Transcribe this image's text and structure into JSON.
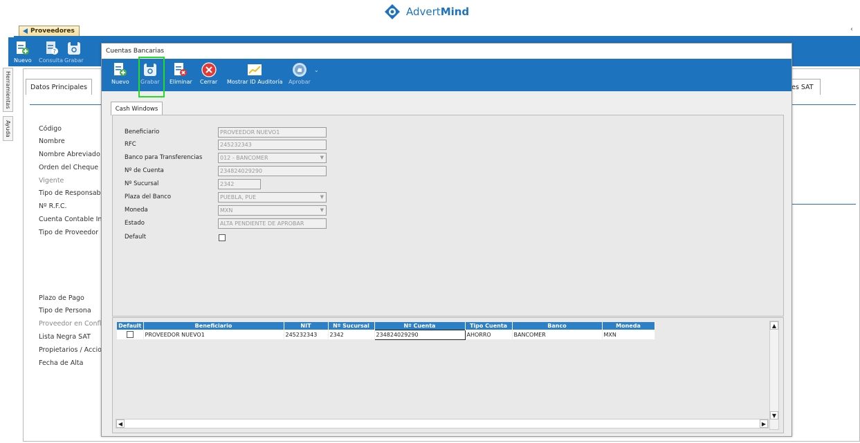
{
  "brand": {
    "name_light": "Advert",
    "name_bold": "Mind",
    "color": "#1e73be"
  },
  "outer": {
    "tab_title": "Proveedores",
    "toolbar": [
      {
        "label": "Nuevo",
        "icon": "new-doc-icon"
      },
      {
        "label": "Consulta",
        "icon": "query-doc-icon"
      },
      {
        "label": "Grabar",
        "icon": "save-icon"
      }
    ],
    "side_tabs": [
      "Herramientas",
      "Ayuda"
    ],
    "tabs": {
      "datos": "Datos Principales",
      "sat": "es SAT"
    },
    "labels": [
      "Código",
      "Nombre",
      "Nombre Abreviado",
      "Orden del Cheque",
      "Vigente",
      "Tipo de Responsable",
      "Nº R.F.C.",
      "Cuenta Contable Ind",
      "Tipo de Proveedor",
      "Plazo de Pago",
      "Tipo de Persona",
      "Proveedor en Confli",
      "Lista Negra SAT",
      "Propietarios / Accio",
      "Fecha de Alta"
    ]
  },
  "modal": {
    "title": "Cuentas Bancarias",
    "toolbar": [
      {
        "label": "Nuevo",
        "icon": "new-doc-icon",
        "enabled": true
      },
      {
        "label": "Grabar",
        "icon": "save-icon",
        "enabled": false
      },
      {
        "label": "Eliminar",
        "icon": "delete-doc-icon",
        "enabled": true
      },
      {
        "label": "Cerrar",
        "icon": "close-icon",
        "enabled": true
      },
      {
        "label": "Mostrar ID Auditoría",
        "icon": "chart-icon",
        "enabled": true
      },
      {
        "label": "Aprobar",
        "icon": "thumbs-up-icon",
        "enabled": false
      }
    ],
    "tab": "Cash Windows",
    "form": {
      "beneficiario": {
        "label": "Beneficiario",
        "value": "PROVEEDOR NUEVO1"
      },
      "rfc": {
        "label": "RFC",
        "value": "245232343"
      },
      "banco": {
        "label": "Banco para Transferencias",
        "value": "012  -  BANCOMER"
      },
      "cuenta": {
        "label": "Nº de Cuenta",
        "value": "234824029290"
      },
      "sucursal": {
        "label": "Nº Sucursal",
        "value": "2342"
      },
      "plaza": {
        "label": "Plaza del Banco",
        "value": "PUEBLA, PUE"
      },
      "moneda": {
        "label": "Moneda",
        "value": "MXN"
      },
      "estado": {
        "label": "Estado",
        "value": "ALTA PENDIENTE DE APROBAR"
      },
      "default": {
        "label": "Default",
        "checked": false
      }
    },
    "grid": {
      "columns": [
        "Default",
        "Beneficiario",
        "NIT",
        "Nº Sucursal",
        "Nº Cuenta",
        "Tipo Cuenta",
        "Banco",
        "Moneda"
      ],
      "rows": [
        {
          "default": false,
          "beneficiario": "PROVEEDOR NUEVO1",
          "nit": "245232343",
          "sucursal": "2342",
          "cuenta": "234824029290",
          "tipo": "AHORRO",
          "banco": "BANCOMER",
          "moneda": "MXN"
        }
      ]
    }
  }
}
